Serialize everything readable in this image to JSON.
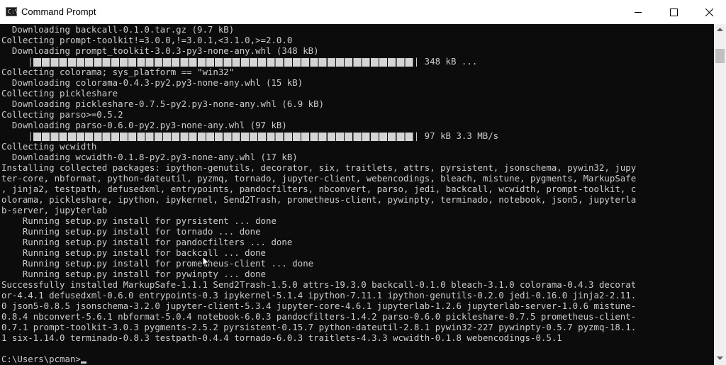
{
  "window": {
    "title": "Command Prompt",
    "icon_text": "C:\\",
    "icons": {
      "app": "cmd-icon",
      "minimize": "minimize-icon",
      "maximize": "maximize-icon",
      "close": "close-icon"
    }
  },
  "console": {
    "line_0": "  Downloading backcall-0.1.0.tar.gz (9.7 kB)",
    "line_1": "Collecting prompt-toolkit!=3.0.0,!=3.0.1,<3.1.0,>=2.0.0",
    "line_2": "  Downloading prompt_toolkit-3.0.3-py3-none-any.whl (348 kB)",
    "line_3_prefix": "     |",
    "line_3_suffix": "| 348 kB ...",
    "line_4": "Collecting colorama; sys_platform == \"win32\"",
    "line_5": "  Downloading colorama-0.4.3-py2.py3-none-any.whl (15 kB)",
    "line_6": "Collecting pickleshare",
    "line_7": "  Downloading pickleshare-0.7.5-py2.py3-none-any.whl (6.9 kB)",
    "line_8": "Collecting parso>=0.5.2",
    "line_9": "  Downloading parso-0.6.0-py2.py3-none-any.whl (97 kB)",
    "line_10_prefix": "     |",
    "line_10_suffix": "| 97 kB 3.3 MB/s",
    "line_11": "Collecting wcwidth",
    "line_12": "  Downloading wcwidth-0.1.8-py2.py3-none-any.whl (17 kB)",
    "line_13": "Installing collected packages: ipython-genutils, decorator, six, traitlets, attrs, pyrsistent, jsonschema, pywin32, jupy",
    "line_14": "ter-core, nbformat, python-dateutil, pyzmq, tornado, jupyter-client, webencodings, bleach, mistune, pygments, MarkupSafe",
    "line_15": ", jinja2, testpath, defusedxml, entrypoints, pandocfilters, nbconvert, parso, jedi, backcall, wcwidth, prompt-toolkit, c",
    "line_16": "olorama, pickleshare, ipython, ipykernel, Send2Trash, prometheus-client, pywinpty, terminado, notebook, json5, jupyterla",
    "line_17": "b-server, jupyterlab",
    "line_18": "    Running setup.py install for pyrsistent ... done",
    "line_19": "    Running setup.py install for tornado ... done",
    "line_20": "    Running setup.py install for pandocfilters ... done",
    "line_21": "    Running setup.py install for backcall ... done",
    "line_22": "    Running setup.py install for prometheus-client ... done",
    "line_23": "    Running setup.py install for pywinpty ... done",
    "line_24": "Successfully installed MarkupSafe-1.1.1 Send2Trash-1.5.0 attrs-19.3.0 backcall-0.1.0 bleach-3.1.0 colorama-0.4.3 decorat",
    "line_25": "or-4.4.1 defusedxml-0.6.0 entrypoints-0.3 ipykernel-5.1.4 ipython-7.11.1 ipython-genutils-0.2.0 jedi-0.16.0 jinja2-2.11.",
    "line_26": "0 json5-0.8.5 jsonschema-3.2.0 jupyter-client-5.3.4 jupyter-core-4.6.1 jupyterlab-1.2.6 jupyterlab-server-1.0.6 mistune-",
    "line_27": "0.8.4 nbconvert-5.6.1 nbformat-5.0.4 notebook-6.0.3 pandocfilters-1.4.2 parso-0.6.0 pickleshare-0.7.5 prometheus-client-",
    "line_28": "0.7.1 prompt-toolkit-3.0.3 pygments-2.5.2 pyrsistent-0.15.7 python-dateutil-2.8.1 pywin32-227 pywinpty-0.5.7 pyzmq-18.1.",
    "line_29": "1 six-1.14.0 terminado-0.8.3 testpath-0.4.4 tornado-6.0.3 traitlets-4.3.3 wcwidth-0.1.8 webencodings-0.5.1",
    "line_30": "",
    "prompt": "C:\\Users\\pcman>",
    "progress_1": 1.0,
    "progress_2": 1.0
  }
}
